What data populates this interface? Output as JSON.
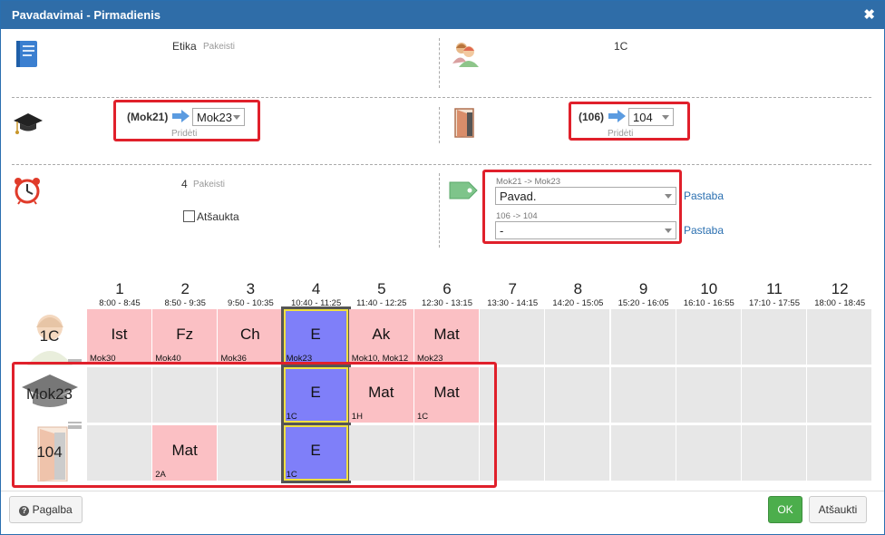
{
  "title": "Pavadavimai - Pirmadienis",
  "subject": {
    "name": "Etika",
    "change": "Pakeisti"
  },
  "class": {
    "name": "1C"
  },
  "teacher": {
    "old": "(Mok21)",
    "new": "Mok23",
    "add": "Pridėti"
  },
  "room": {
    "old": "(106)",
    "new": "104",
    "add": "Pridėti"
  },
  "lesson": {
    "number": "4",
    "change": "Pakeisti",
    "cancelled_label": "Atšaukta"
  },
  "notes": [
    {
      "caption": "Mok21 -> Mok23",
      "value": "Pavad.",
      "link": "Pastaba"
    },
    {
      "caption": "106 -> 104",
      "value": "-",
      "link": "Pastaba"
    }
  ],
  "periods": [
    {
      "num": "1",
      "time": "8:00 - 8:45"
    },
    {
      "num": "2",
      "time": "8:50 - 9:35"
    },
    {
      "num": "3",
      "time": "9:50 - 10:35"
    },
    {
      "num": "4",
      "time": "10:40 - 11:25"
    },
    {
      "num": "5",
      "time": "11:40 - 12:25"
    },
    {
      "num": "6",
      "time": "12:30 - 13:15"
    },
    {
      "num": "7",
      "time": "13:30 - 14:15"
    },
    {
      "num": "8",
      "time": "14:20 - 15:05"
    },
    {
      "num": "9",
      "time": "15:20 - 16:05"
    },
    {
      "num": "10",
      "time": "16:10 - 16:55"
    },
    {
      "num": "11",
      "time": "17:10 - 17:55"
    },
    {
      "num": "12",
      "time": "18:00 - 18:45"
    }
  ],
  "rows": [
    {
      "label": "1C",
      "cells": [
        {
          "subj": "Ist",
          "sub": "Mok30",
          "color": "pink"
        },
        {
          "subj": "Fz",
          "sub": "Mok40",
          "color": "pink"
        },
        {
          "subj": "Ch",
          "sub": "Mok36",
          "color": "pink"
        },
        {
          "subj": "E",
          "sub": "Mok23",
          "color": "blue",
          "hl": true
        },
        {
          "subj": "Ak",
          "sub": "Mok10, Mok12",
          "color": "pink"
        },
        {
          "subj": "Mat",
          "sub": "Mok23",
          "color": "pink"
        },
        {},
        {},
        {},
        {},
        {},
        {}
      ]
    },
    {
      "label": "Mok23",
      "cells": [
        {},
        {},
        {},
        {
          "subj": "E",
          "sub": "1C",
          "color": "blue",
          "hl": true
        },
        {
          "subj": "Mat",
          "sub": "1H",
          "color": "pink"
        },
        {
          "subj": "Mat",
          "sub": "1C",
          "color": "pink"
        },
        {},
        {},
        {},
        {},
        {},
        {}
      ]
    },
    {
      "label": "104",
      "cells": [
        {},
        {
          "subj": "Mat",
          "sub": "2A",
          "color": "pink"
        },
        {},
        {
          "subj": "E",
          "sub": "1C",
          "color": "blue",
          "hl": true
        },
        {},
        {},
        {},
        {},
        {},
        {},
        {},
        {}
      ]
    }
  ],
  "footer": {
    "help": "Pagalba",
    "ok": "OK",
    "cancel": "Atšaukti"
  },
  "colors": {
    "title_bar": "#2f6da8",
    "change_red": "#e0202b",
    "pink_cell": "#fbc0c4",
    "blue_cell": "#7f7ff9",
    "ok_green": "#4cae4c"
  }
}
